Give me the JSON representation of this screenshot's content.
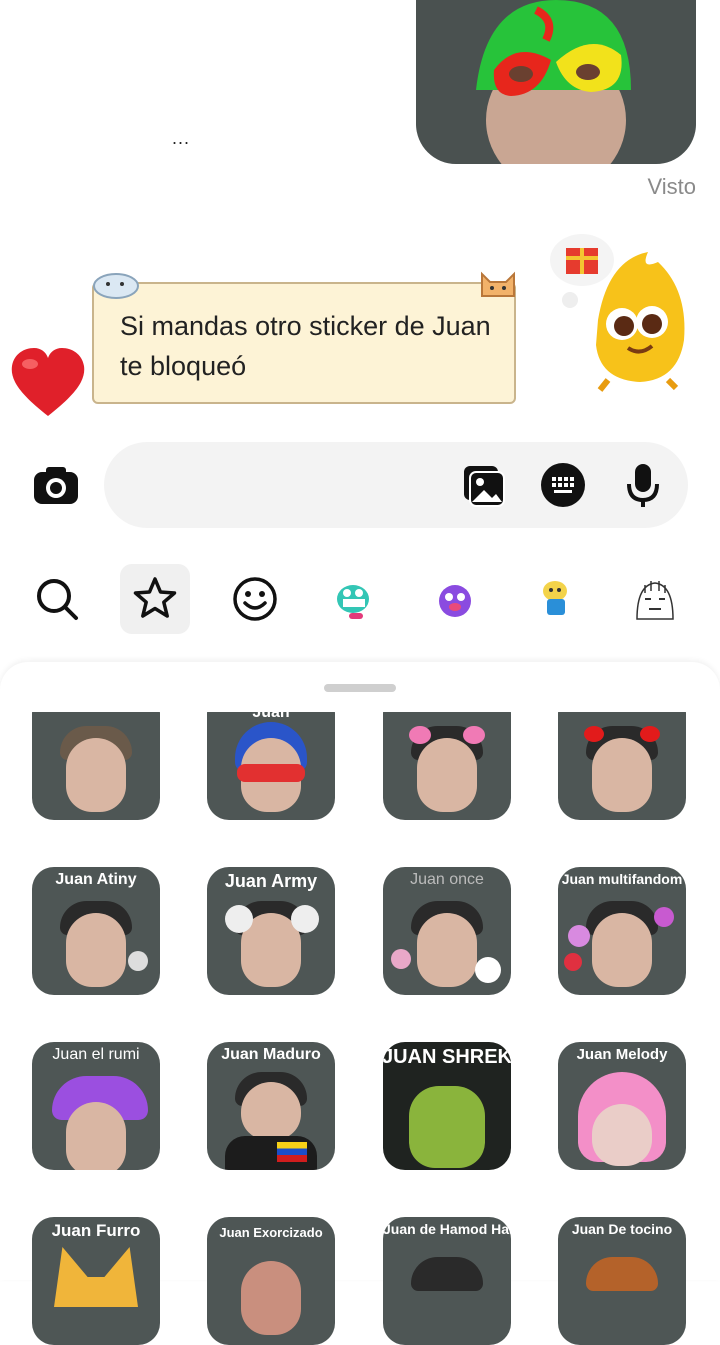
{
  "chat": {
    "typing_indicator": "...",
    "seen_label": "Visto",
    "message_text": "Si mandas otro sticker de Juan te bloqueó"
  },
  "composer": {
    "placeholder": "",
    "camera_icon": "camera-icon",
    "gallery_icon": "gallery-icon",
    "sticker_keyboard_icon": "keyboard-icon",
    "mic_icon": "microphone-icon"
  },
  "sticker_tabs": [
    {
      "name": "search-icon"
    },
    {
      "name": "star-icon",
      "active": true
    },
    {
      "name": "smiley-icon"
    },
    {
      "name": "sticker-pack-1"
    },
    {
      "name": "sticker-pack-2"
    },
    {
      "name": "sticker-pack-3"
    },
    {
      "name": "sticker-pack-4"
    }
  ],
  "stickers": {
    "row1": [
      "",
      "Juan",
      "",
      ""
    ],
    "row2": [
      "Juan Atiny",
      "Juan Army",
      "Juan once",
      "Juan multifandom"
    ],
    "row3": [
      "Juan el rumi",
      "Juan Maduro",
      "JUAN SHREK",
      "Juan Melody"
    ],
    "row4": [
      "Juan Furro",
      "Juan Exorcizado",
      "Juan de Hamod Habibi",
      "Juan De tocino"
    ]
  },
  "colors": {
    "sticker_bg": "#4e5655",
    "note_bg": "#fdf3d6",
    "heart": "#e0202a"
  }
}
